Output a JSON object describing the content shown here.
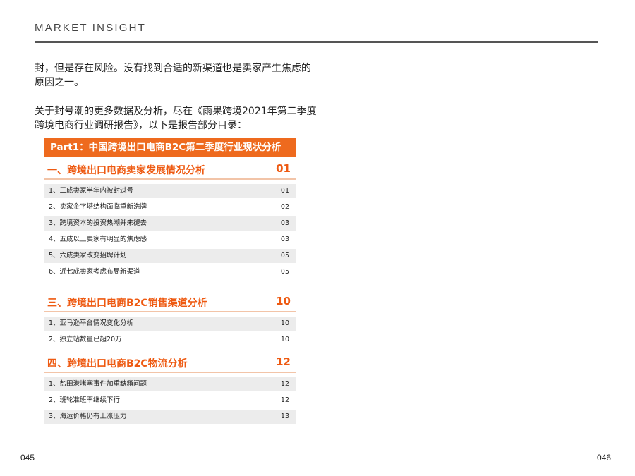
{
  "header": {
    "title": "MARKET INSIGHT"
  },
  "body": {
    "paragraph1": "封，但是存在风险。没有找到合适的新渠道也是卖家产生焦虑的原因之一。",
    "paragraph2": "关于封号潮的更多数据及分析，尽在《雨果跨境2021年第二季度跨境电商行业调研报告》，以下是报告部分目录："
  },
  "toc": {
    "banner": "Part1：中国跨境出口电商B2C第二季度行业现状分析",
    "sections": [
      {
        "title": "一、跨境出口电商卖家发展情况分析",
        "page": "01",
        "items": [
          {
            "label": "1、三成卖家半年内被封过号",
            "page": "01"
          },
          {
            "label": "2、卖家金字塔结构面临重新洗牌",
            "page": "02"
          },
          {
            "label": "3、跨境资本的投资热潮并未褪去",
            "page": "03"
          },
          {
            "label": "4、五成以上卖家有明显的焦虑感",
            "page": "03"
          },
          {
            "label": "5、六成卖家改变招聘计划",
            "page": "05"
          },
          {
            "label": "6、近七成卖家考虑布局新渠道",
            "page": "05"
          }
        ]
      },
      {
        "title": "三、跨境出口电商B2C销售渠道分析",
        "page": "10",
        "items": [
          {
            "label": "1、亚马逊平台情况变化分析",
            "page": "10"
          },
          {
            "label": "2、独立站数量已超20万",
            "page": "10"
          }
        ]
      },
      {
        "title": "四、跨境出口电商B2C物流分析",
        "page": "12",
        "items": [
          {
            "label": "1、盐田港堵塞事件加重缺箱问题",
            "page": "12"
          },
          {
            "label": "2、班轮准班率继续下行",
            "page": "12"
          },
          {
            "label": "3、海运价格仍有上涨压力",
            "page": "13"
          }
        ]
      }
    ]
  },
  "footer": {
    "left_page": "045",
    "right_page": "046"
  }
}
